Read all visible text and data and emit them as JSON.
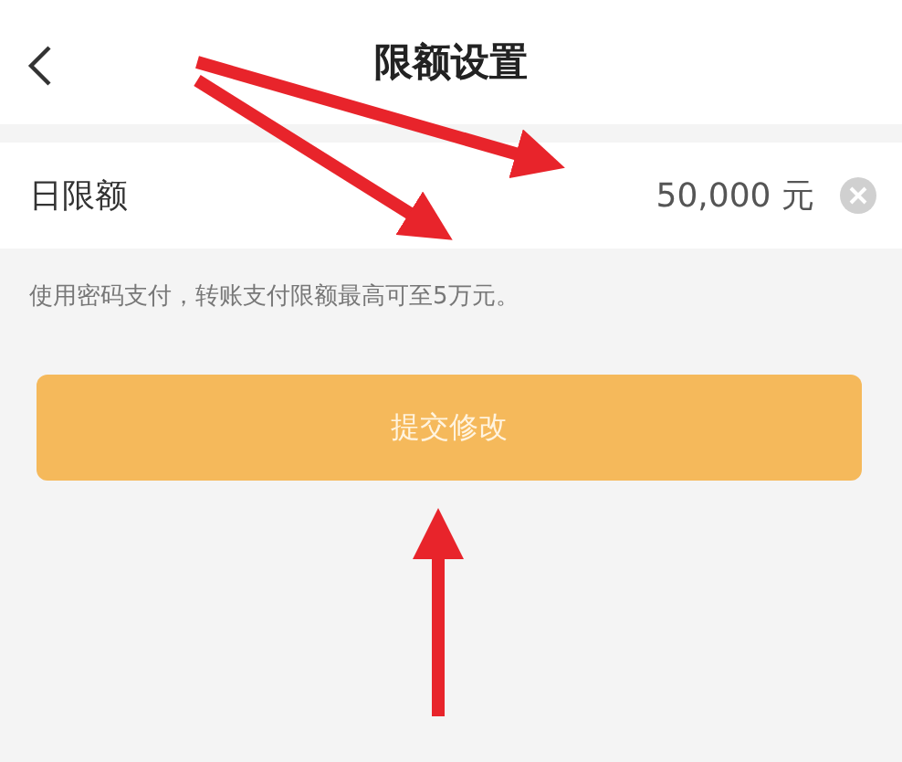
{
  "header": {
    "title": "限额设置"
  },
  "limit_row": {
    "label": "日限额",
    "value": "50,000 元"
  },
  "hint": "使用密码支付，转账支付限额最高可至5万元。",
  "submit_button": {
    "label": "提交修改"
  }
}
